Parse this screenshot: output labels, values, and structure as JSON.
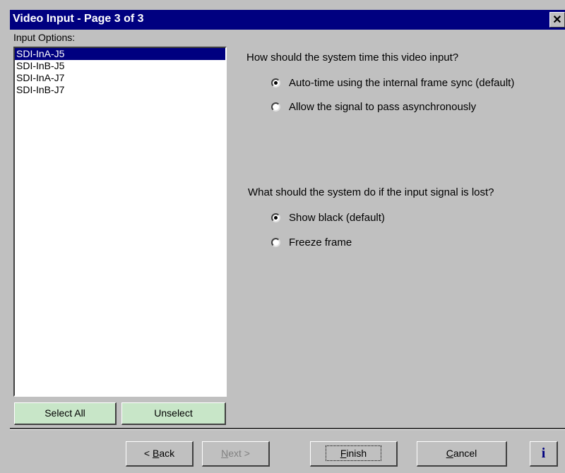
{
  "window": {
    "title": "Video Input - Page 3 of 3",
    "close_label": "✕"
  },
  "input_options": {
    "label": "Input Options:",
    "items": [
      {
        "label": "SDI-InA-J5",
        "selected": true
      },
      {
        "label": "SDI-InB-J5",
        "selected": false
      },
      {
        "label": "SDI-InA-J7",
        "selected": false
      },
      {
        "label": "SDI-InB-J7",
        "selected": false
      }
    ],
    "select_all_label": "Select All",
    "unselect_label": "Unselect",
    "button_color": "#c8e6c8"
  },
  "timing": {
    "question": "How should the system time this video input?",
    "options": [
      {
        "label": "Auto-time using the internal frame sync (default)",
        "checked": true
      },
      {
        "label": "Allow the signal to pass asynchronously",
        "checked": false
      }
    ]
  },
  "signal_loss": {
    "question": "What should the system do if the input signal is lost?",
    "options": [
      {
        "label": "Show black (default)",
        "checked": true
      },
      {
        "label": "Freeze frame",
        "checked": false
      }
    ]
  },
  "footer": {
    "back_pre": "< ",
    "back_key": "B",
    "back_rest": "ack",
    "next_key": "N",
    "next_rest": "ext >",
    "finish_key": "F",
    "finish_rest": "inish",
    "cancel_key": "C",
    "cancel_rest": "ancel",
    "info_label": "i",
    "next_enabled": false
  },
  "colors": {
    "title_bar": "#000080",
    "dialog_face": "#c0c0c0",
    "selection": "#000080"
  }
}
